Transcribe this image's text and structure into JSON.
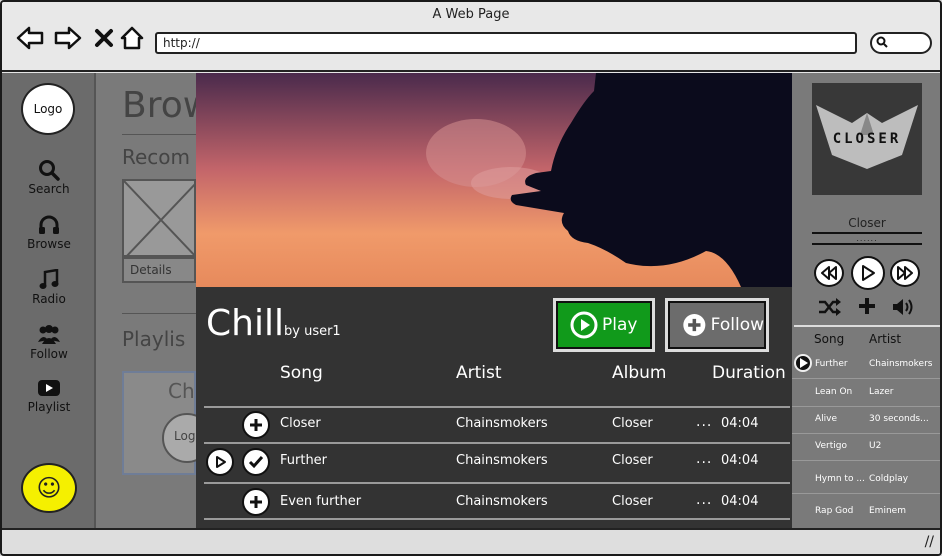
{
  "browser": {
    "title": "A Web Page",
    "url": "http://"
  },
  "left_nav": {
    "logo": "Logo",
    "items": [
      {
        "label": "Search",
        "icon": "search-icon"
      },
      {
        "label": "Browse",
        "icon": "headphones-icon"
      },
      {
        "label": "Radio",
        "icon": "music-note-icon"
      },
      {
        "label": "Follow",
        "icon": "people-icon"
      },
      {
        "label": "Playlist",
        "icon": "youtube-play-icon"
      }
    ],
    "profile_icon": "smiley-icon"
  },
  "background_page": {
    "title": "Brow",
    "recommended": "Recom",
    "details": "Details",
    "playlists": "Playlis",
    "card_title": "Ch",
    "card_logo": "Log"
  },
  "modal": {
    "playlist_title": "Chill",
    "by_label": "by user1",
    "play_label": "Play",
    "follow_label": "Follow",
    "columns": {
      "song": "Song",
      "artist": "Artist",
      "album": "Album",
      "duration": "Duration"
    },
    "songs": [
      {
        "song": "Closer",
        "artist": "Chainsmokers",
        "album": "Closer",
        "more": "...",
        "duration": "04:04",
        "state": "add",
        "playing": false
      },
      {
        "song": "Further",
        "artist": "Chainsmokers",
        "album": "Closer",
        "more": "...",
        "duration": "04:04",
        "state": "added",
        "playing": true
      },
      {
        "song": "Even further",
        "artist": "Chainsmokers",
        "album": "Closer",
        "more": "...",
        "duration": "04:04",
        "state": "add",
        "playing": false
      }
    ]
  },
  "player": {
    "album_art_text": "CLOSER",
    "now_playing": "Closer",
    "progress_dots": "......",
    "controls": [
      "rewind-icon",
      "play-icon",
      "fast-forward-icon",
      "shuffle-icon",
      "add-icon",
      "volume-icon"
    ],
    "queue_headers": {
      "song": "Song",
      "artist": "Artist"
    },
    "queue": [
      {
        "song": "Further",
        "artist": "Chainsmokers",
        "playing": true
      },
      {
        "song": "Lean On",
        "artist": "Lazer",
        "playing": false
      },
      {
        "song": "Alive",
        "artist": "30 seconds...",
        "playing": false
      },
      {
        "song": "Vertigo",
        "artist": "U2",
        "playing": false
      },
      {
        "song": "Hymn to ...",
        "artist": "Coldplay",
        "playing": false
      },
      {
        "song": "Rap God",
        "artist": "Eminem",
        "playing": false
      }
    ]
  },
  "colors": {
    "play_green": "#119a1b",
    "modal_bg": "#333333",
    "smiley_yellow": "#f5f000"
  }
}
